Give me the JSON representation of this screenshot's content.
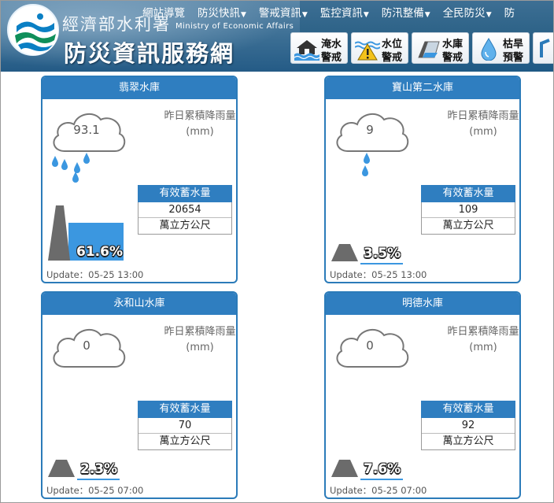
{
  "header": {
    "ministry": "經濟部水利署",
    "ministry_en": "Ministry of Economic Affairs",
    "site_title": "防災資訊服務網",
    "nav": [
      {
        "label": "網站導覽",
        "dropdown": false
      },
      {
        "label": "防災快訊",
        "dropdown": true
      },
      {
        "label": "警戒資訊",
        "dropdown": true
      },
      {
        "label": "監控資訊",
        "dropdown": true
      },
      {
        "label": "防汛整備",
        "dropdown": true
      },
      {
        "label": "全民防災",
        "dropdown": true
      },
      {
        "label": "防",
        "dropdown": false
      }
    ],
    "alerts": [
      {
        "line1": "淹水",
        "line2": "警戒",
        "icon": "flood-house-icon"
      },
      {
        "line1": "水位",
        "line2": "警戒",
        "icon": "water-level-warning-icon"
      },
      {
        "line1": "水庫",
        "line2": "警戒",
        "icon": "reservoir-icon"
      },
      {
        "line1": "枯旱",
        "line2": "預警",
        "icon": "water-drop-icon"
      }
    ]
  },
  "common": {
    "rain_label_1": "昨日累積降雨量",
    "rain_label_2": "(mm)",
    "storage_title": "有效蓄水量",
    "storage_unit": "萬立方公尺"
  },
  "reservoirs": [
    {
      "name": "翡翠水庫",
      "rainfall": "93.1",
      "storage": "20654",
      "percent": "61.6%",
      "percent_value": 61.6,
      "update": "Update：05-25 13:00",
      "rain_drops": 5
    },
    {
      "name": "寶山第二水庫",
      "rainfall": "9",
      "storage": "109",
      "percent": "3.5%",
      "percent_value": 3.5,
      "update": "Update：05-25 13:00",
      "rain_drops": 2
    },
    {
      "name": "永和山水庫",
      "rainfall": "0",
      "storage": "70",
      "percent": "2.3%",
      "percent_value": 2.3,
      "update": "Update：05-25 07:00",
      "rain_drops": 0
    },
    {
      "name": "明德水庫",
      "rainfall": "0",
      "storage": "92",
      "percent": "7.6%",
      "percent_value": 7.6,
      "update": "Update：05-25 07:00",
      "rain_drops": 0
    }
  ],
  "colors": {
    "accent": "#2f7ec0",
    "water": "#3b97e0",
    "dam": "#6b6b6b"
  }
}
